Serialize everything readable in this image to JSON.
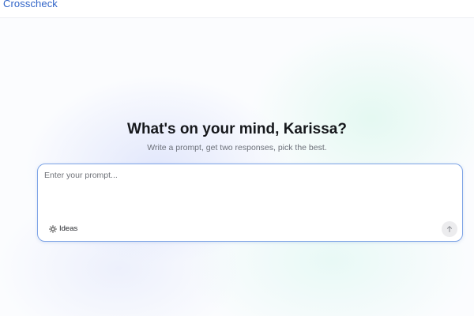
{
  "app": {
    "brand": "Crosscheck"
  },
  "main": {
    "heading": "What's on your mind, Karissa?",
    "subheading": "Write a prompt, get two responses, pick the best."
  },
  "prompt": {
    "placeholder": "Enter your prompt...",
    "value": "",
    "ideas_label": "Ideas",
    "ideas_icon": "lightbulb-icon",
    "send_icon": "arrow-up-icon"
  },
  "colors": {
    "brand": "#2f63c7",
    "input_border": "#7ea4e6",
    "send_button_bg": "#ececee"
  }
}
